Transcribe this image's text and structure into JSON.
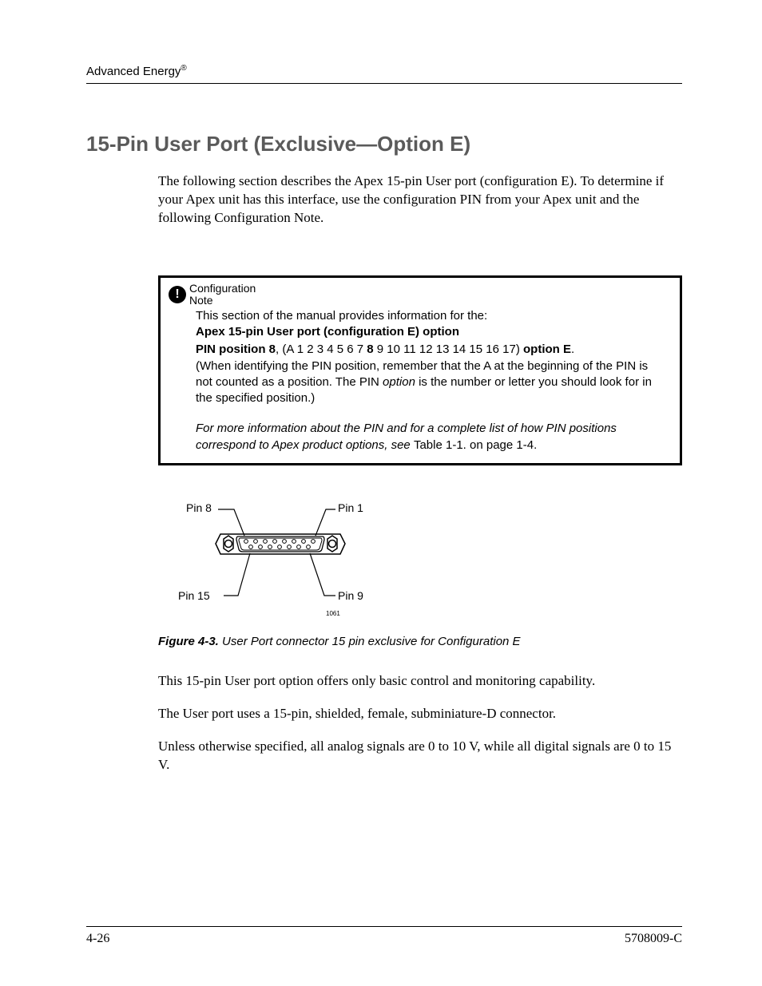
{
  "header": {
    "brand": "Advanced Energy",
    "reg": "®"
  },
  "title": "15-Pin User Port (Exclusive—Option E)",
  "intro": "The following section describes the Apex 15-pin User port (configuration E). To determine if your Apex unit has this interface, use the configuration PIN from your Apex unit and the following Configuration Note.",
  "config": {
    "label_line1": "Configuration",
    "label_line2": "Note",
    "l1": "This section of the manual provides information for the:",
    "l2": "Apex 15-pin User port (configuration E) option",
    "pin_prefix": "PIN position 8",
    "pin_mid_a": ", (A 1 2 3 4 5 6 7 ",
    "pin_bold8": "8",
    "pin_mid_b": " 9 10 11 12 13 14 15 16 17) ",
    "pin_suffix": "option E",
    "pin_end": ".",
    "l3a": "(When identifying the PIN position, remember that the A at the beginning of the PIN is not counted as a position. The PIN ",
    "l3b": "option",
    "l3c": " is the number or letter you should look for in the specified position.)",
    "foot_it": "For more information about the PIN and for a complete list of how PIN positions correspond to Apex product options, see ",
    "foot_ref": "Table 1-1. on page 1-4."
  },
  "figure": {
    "pin8": "Pin 8",
    "pin1": "Pin 1",
    "pin15": "Pin 15",
    "pin9": "Pin 9",
    "code": "1061",
    "label": "Figure 4-3.",
    "caption": "User Port connector 15 pin exclusive for Configuration E"
  },
  "paras": {
    "p1": "This 15-pin User port option offers only basic control and monitoring capability.",
    "p2": "The User port uses a 15-pin, shielded, female, subminiature-D connector.",
    "p3": "Unless otherwise specified, all analog signals are 0 to 10 V, while all digital signals are 0 to 15 V."
  },
  "footer": {
    "left": "4-26",
    "right": "5708009-C"
  }
}
